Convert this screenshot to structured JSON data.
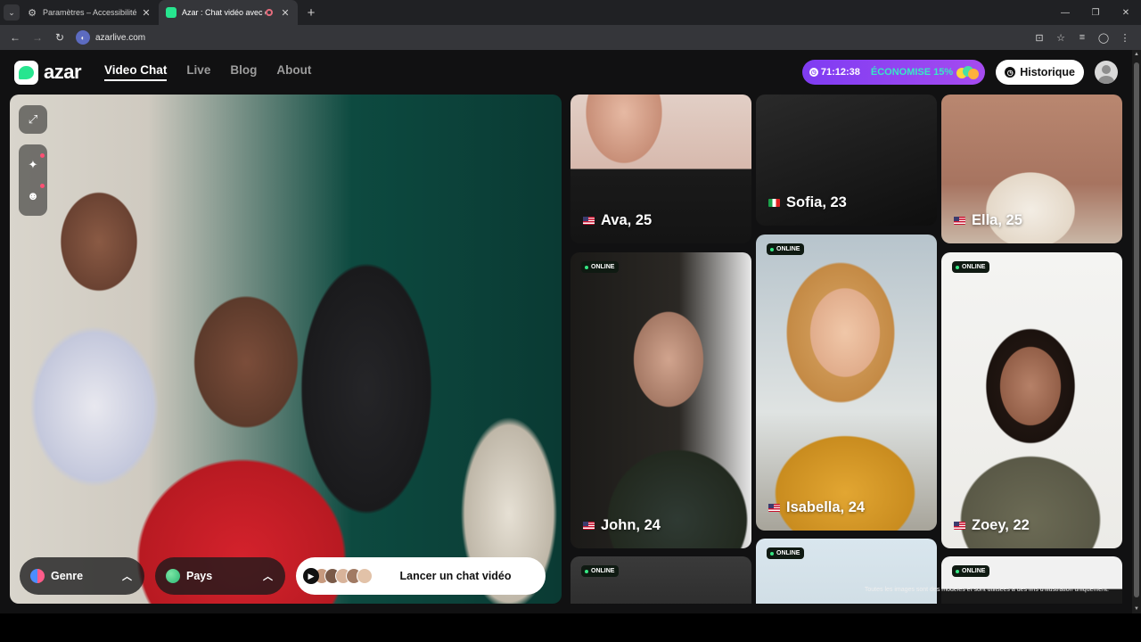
{
  "browser": {
    "tabs": [
      {
        "title": "Paramètres – Accessibilité",
        "active": false,
        "icon": "gear-icon"
      },
      {
        "title": "Azar : Chat vidéo avec de n",
        "active": true,
        "icon": "azar-favicon"
      }
    ],
    "url": "azarlive.com"
  },
  "header": {
    "brand": "azar",
    "nav": [
      {
        "label": "Video Chat",
        "active": true
      },
      {
        "label": "Live",
        "active": false
      },
      {
        "label": "Blog",
        "active": false
      },
      {
        "label": "About",
        "active": false
      }
    ],
    "promo": {
      "timer": "71:12:38",
      "save": "ÉCONOMISE 15%"
    },
    "history_label": "Historique"
  },
  "video": {
    "filters": {
      "gender": "Genre",
      "country": "Pays"
    },
    "start_label": "Lancer un chat vidéo"
  },
  "profiles": [
    {
      "name": "Ava, 25",
      "flag": "us",
      "online": false
    },
    {
      "name": "Sofia, 23",
      "flag": "it",
      "online": false
    },
    {
      "name": "Ella, 25",
      "flag": "us",
      "online": false
    },
    {
      "name": "John, 24",
      "flag": "us",
      "online": true
    },
    {
      "name": "Isabella, 24",
      "flag": "us",
      "online": true
    },
    {
      "name": "Zoey, 22",
      "flag": "us",
      "online": true
    },
    {
      "name": "",
      "flag": "",
      "online": true
    },
    {
      "name": "",
      "flag": "",
      "online": true
    },
    {
      "name": "",
      "flag": "",
      "online": true
    }
  ],
  "online_badge": "ONLINE",
  "disclaimer": "Toutes les images sont des modèles et sont utilisées à des fins d'illustration uniquement.",
  "colors": {
    "accent_green": "#27e58f",
    "promo_purple": "#8a3ff1",
    "online_green": "#35e883"
  }
}
